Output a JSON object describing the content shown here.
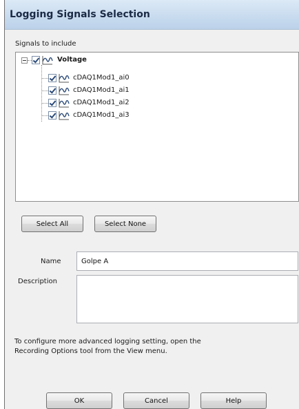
{
  "window": {
    "title": "Logging Signals Selection"
  },
  "signals": {
    "group_label": "Signals to include",
    "tree": {
      "root": {
        "label": "Voltage",
        "checked": true,
        "expanded": true
      },
      "children": [
        {
          "label": "cDAQ1Mod1_ai0",
          "checked": true
        },
        {
          "label": "cDAQ1Mod1_ai1",
          "checked": true
        },
        {
          "label": "cDAQ1Mod1_ai2",
          "checked": true
        },
        {
          "label": "cDAQ1Mod1_ai3",
          "checked": true
        }
      ]
    }
  },
  "selection_buttons": {
    "select_all": "Select All",
    "select_none": "Select None"
  },
  "form": {
    "name_label": "Name",
    "name_value": "Golpe A",
    "description_label": "Description",
    "description_value": ""
  },
  "hint": {
    "line1": "To configure more advanced logging setting, open the",
    "line2": "Recording Options tool from the View menu."
  },
  "footer_buttons": {
    "ok": "OK",
    "cancel": "Cancel",
    "help": "Help"
  },
  "colors": {
    "titlebar": "#c9dcef",
    "title_text": "#1b2b45",
    "check": "#2b4a78",
    "signal_icon": "#2b4a78"
  },
  "icons": {
    "expander": "minus-expander-icon",
    "checkbox": "checkbox-checked-icon",
    "signal": "waveform-icon"
  }
}
